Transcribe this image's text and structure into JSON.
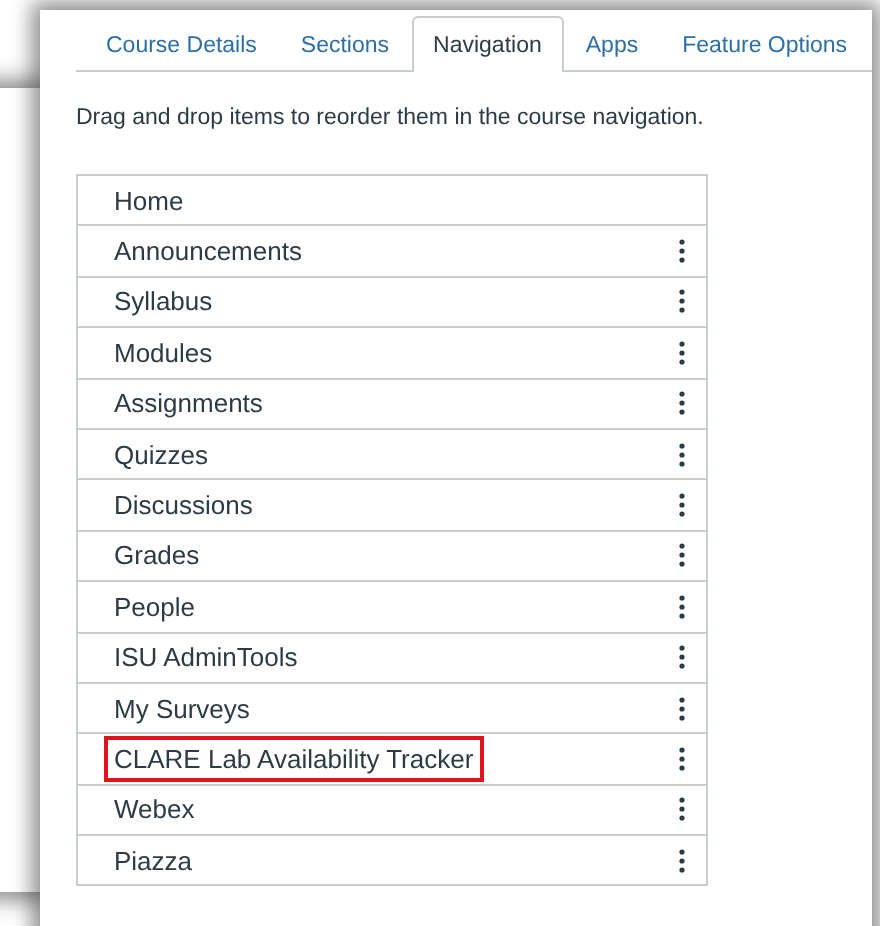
{
  "tabs": [
    {
      "label": "Course Details",
      "selected": false
    },
    {
      "label": "Sections",
      "selected": false
    },
    {
      "label": "Navigation",
      "selected": true
    },
    {
      "label": "Apps",
      "selected": false
    },
    {
      "label": "Feature Options",
      "selected": false
    }
  ],
  "instructions": "Drag and drop items to reorder them in the course navigation.",
  "navigation_items": [
    {
      "label": "Home",
      "has_menu": false,
      "highlighted": false
    },
    {
      "label": "Announcements",
      "has_menu": true,
      "highlighted": false
    },
    {
      "label": "Syllabus",
      "has_menu": true,
      "highlighted": false
    },
    {
      "label": "Modules",
      "has_menu": true,
      "highlighted": false
    },
    {
      "label": "Assignments",
      "has_menu": true,
      "highlighted": false
    },
    {
      "label": "Quizzes",
      "has_menu": true,
      "highlighted": false
    },
    {
      "label": "Discussions",
      "has_menu": true,
      "highlighted": false
    },
    {
      "label": "Grades",
      "has_menu": true,
      "highlighted": false
    },
    {
      "label": "People",
      "has_menu": true,
      "highlighted": false
    },
    {
      "label": "ISU AdminTools",
      "has_menu": true,
      "highlighted": false
    },
    {
      "label": "My Surveys",
      "has_menu": true,
      "highlighted": false
    },
    {
      "label": "CLARE Lab Availability Tracker",
      "has_menu": true,
      "highlighted": true
    },
    {
      "label": "Webex",
      "has_menu": true,
      "highlighted": false
    },
    {
      "label": "Piazza",
      "has_menu": true,
      "highlighted": false
    }
  ]
}
